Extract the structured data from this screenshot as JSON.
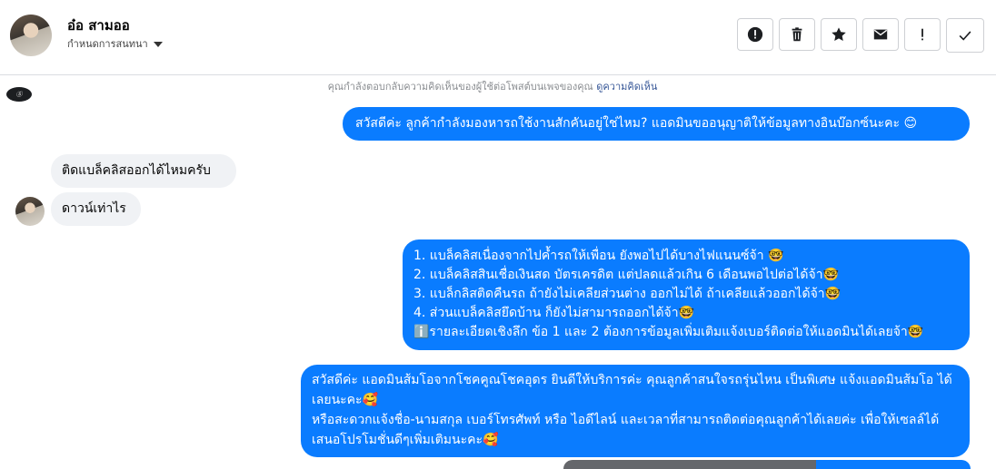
{
  "header": {
    "contact_name": "อ๋อ สามออ",
    "subtitle": "กำหนดการสนทนา"
  },
  "toolbar": {
    "buttons": [
      "alert-circle",
      "trash",
      "star",
      "mail",
      "exclamation",
      "check"
    ]
  },
  "thread": {
    "notice": "คุณกำลังตอบกลับความคิดเห็นของผู้ใช้ต่อโพสต์บนเพจของคุณ",
    "notice_link": "ดูความคิดเห็น",
    "page_logo_text": "Ⓢ",
    "messages": [
      {
        "direction": "out",
        "lines": [
          "สวัสดีค่ะ ลูกค้ากำลังมองหารถใช้งานสักคันอยู่ใช่ไหม? แอดมินขออนุญาติให้ข้อมูลทางอินบ๊อกซ์นะคะ 😊"
        ]
      },
      {
        "direction": "in",
        "lines": [
          "ติดแบล็คลิสออกได้ไหมครับ"
        ]
      },
      {
        "direction": "in",
        "lines": [
          "ดาวน์เท่าไร"
        ]
      },
      {
        "direction": "out",
        "lines": [
          "1. แบล็คลิสเนื่องจากไปค้ำรถให้เพื่อน ยังพอไปได้บางไฟแนนซ์จ้า 🤓",
          "2. แบล็คลิสสินเชื่อเงินสด บัตรเครดิต แต่ปลดแล้วเกิน 6 เดือนพอไปต่อได้จ้า🤓",
          "3. แบล็กลิสติดคืนรถ ถ้ายังไม่เคลียส่วนต่าง ออกไม่ได้ ถ้าเคลียแล้วออกได้จ้า🤓",
          "4. ส่วนแบล็คลิสยึดบ้าน ก็ยังไม่สามารถออกได้จ้า🤓",
          "ℹ️รายละเอียดเชิงลึก ข้อ 1 และ 2 ต้องการข้อมูลเพิ่มเติมแจ้งเบอร์ติดต่อให้แอดมินได้เลยจ้า🤓"
        ]
      },
      {
        "direction": "out",
        "lines": [
          "สวัสดีค่ะ แอดมินส้มโอจากโชคคูณโชคอุดร ยินดีให้บริการค่ะ   คุณลูกค้าสนใจรถรุ่นไหน เป็นพิเศษ แจ้งแอดมินส้มโอ ได้เลยนะคะ🥰",
          "หรือสะดวกแจ้งชื่อ-นามสกุล เบอร์โทรศัพท์ หรือ ไอดีไลน์ และเวลาที่สามารถติดต่อคุณลูกค้าได้เลยค่ะ เพื่อให้เซลล์ได้เสนอโปรโมชั่นดีๆเพิ่มเติมนะคะ🥰"
        ]
      }
    ]
  },
  "colors": {
    "outgoing_bubble": "#0a7cff",
    "incoming_bubble": "#f0f2f5",
    "link": "#385898"
  }
}
